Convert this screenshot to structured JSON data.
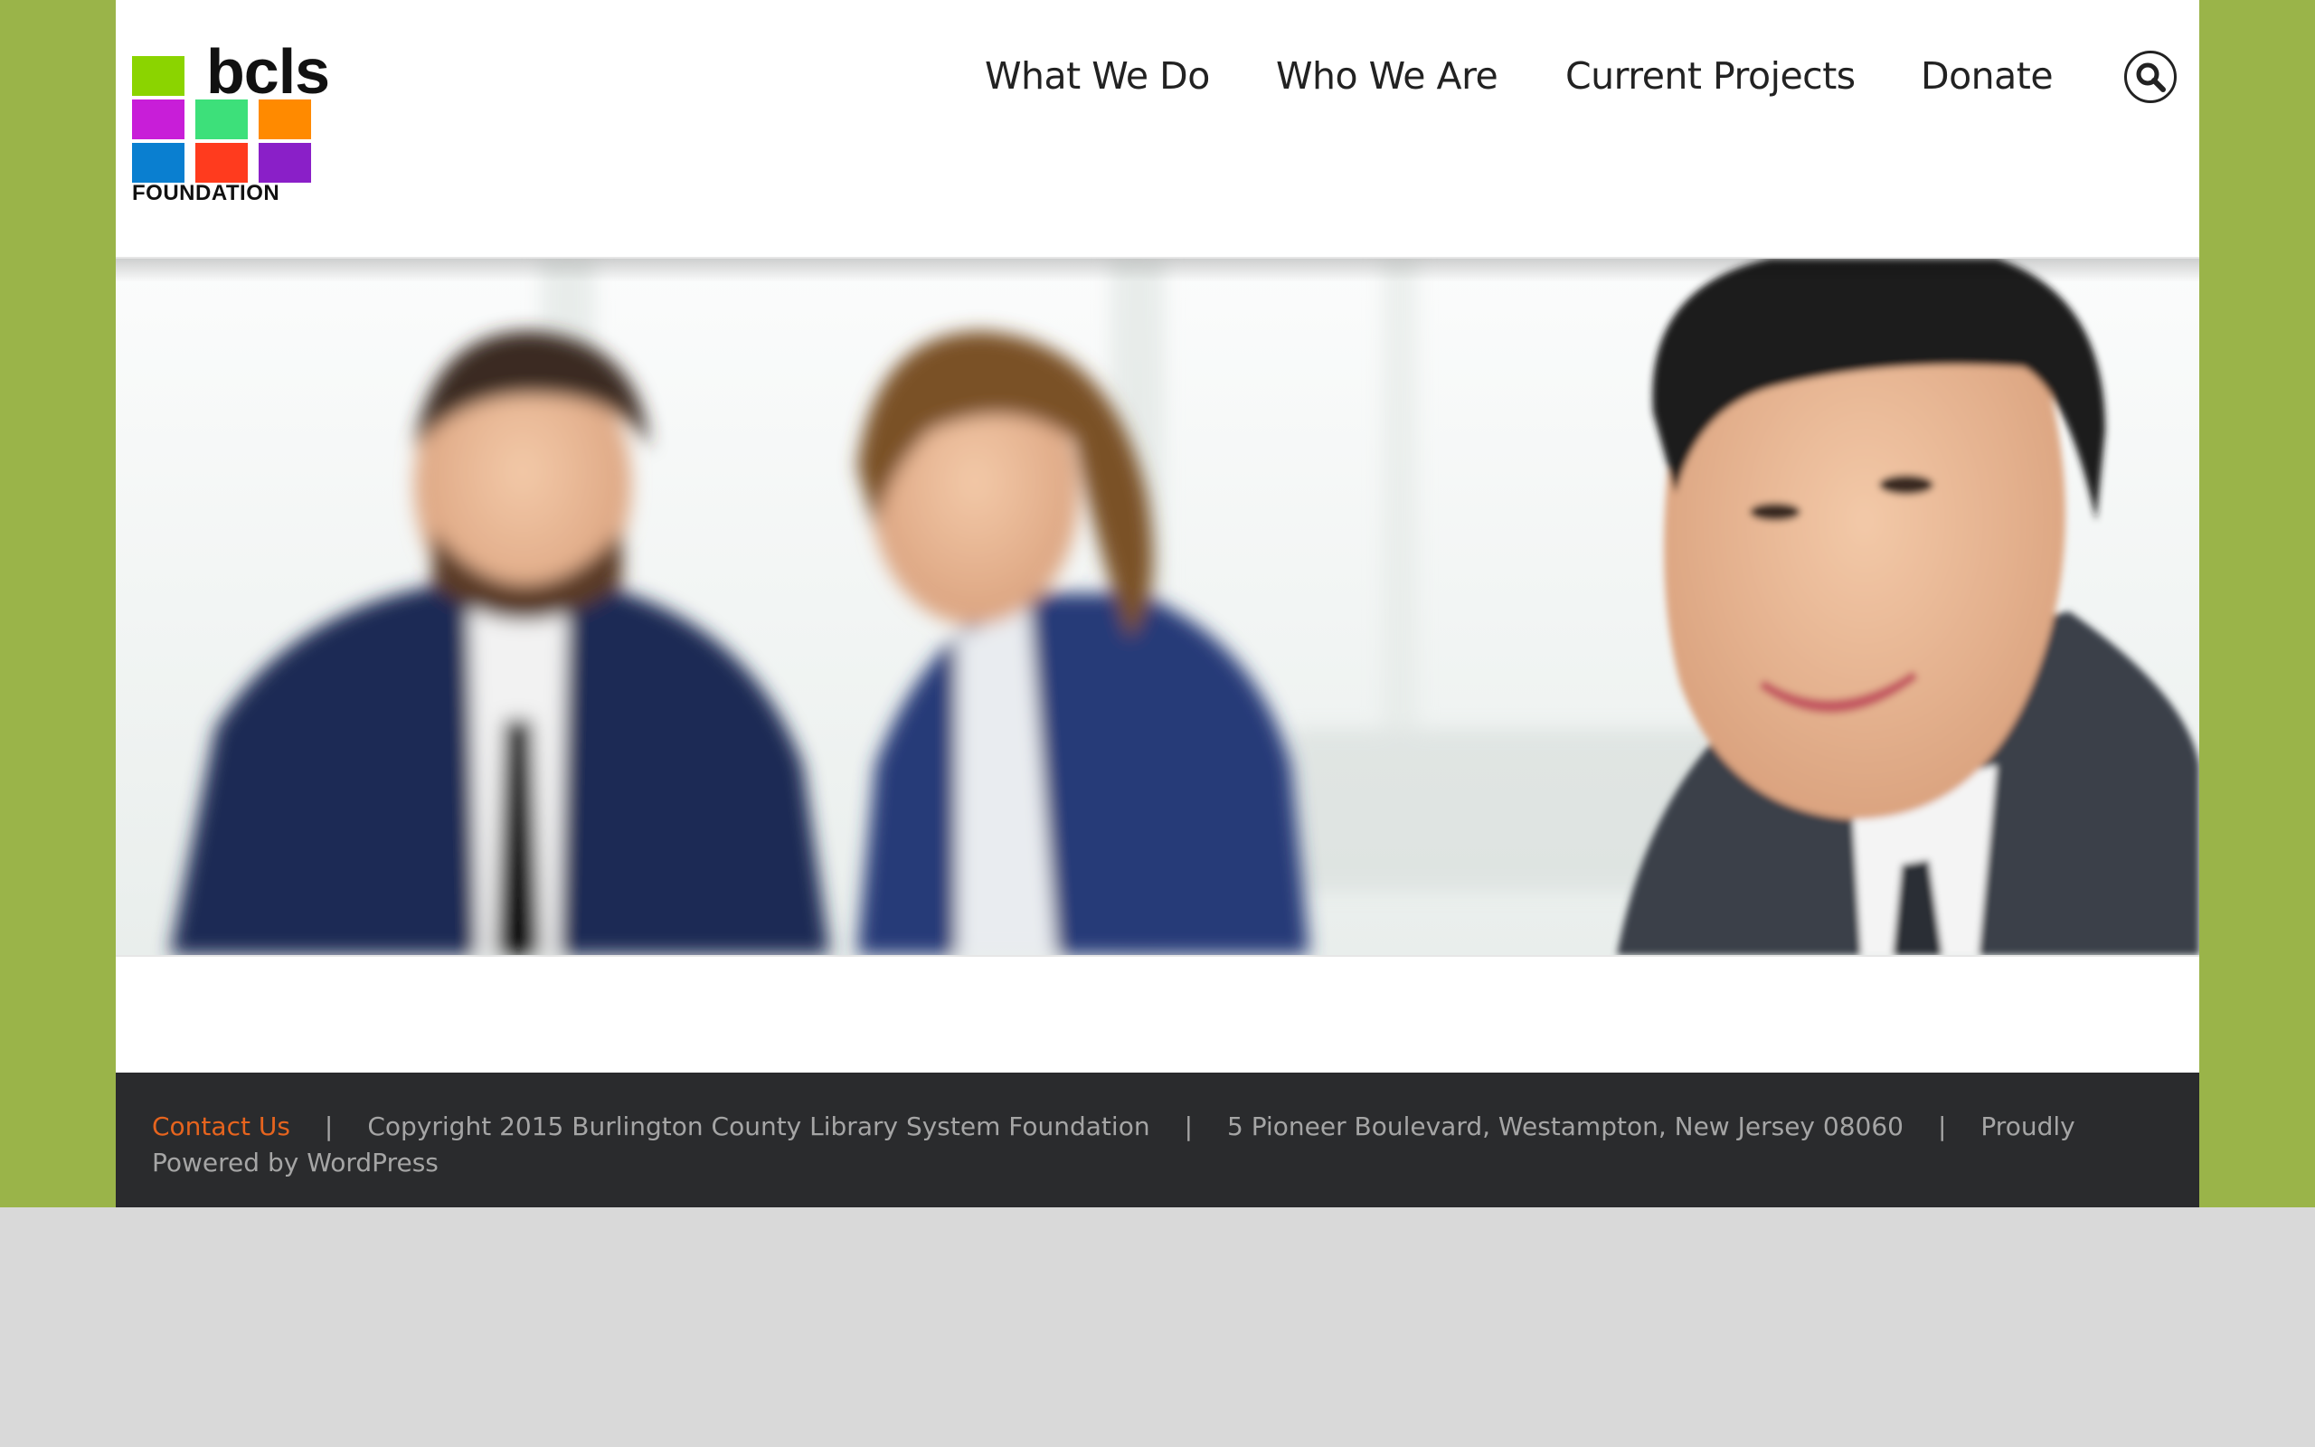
{
  "logo": {
    "word": "bcls",
    "tagline": "FOUNDATION",
    "tile_colors": [
      "#8bd400",
      "#c81ed8",
      "#3de07a",
      "#ff8a00",
      "#0a7fd0",
      "#ff3b1e",
      "#8a1fc8"
    ]
  },
  "nav": {
    "items": [
      {
        "label": "What We Do"
      },
      {
        "label": "Who We Are"
      },
      {
        "label": "Current Projects"
      },
      {
        "label": "Donate"
      }
    ]
  },
  "footer": {
    "contact_label": "Contact Us",
    "separator": "|",
    "copyright": "Copyright 2015 Burlington County Library System Foundation",
    "address": "5 Pioneer Boulevard, Westampton, New Jersey 08060",
    "powered": "Proudly Powered by",
    "wordpress": "WordPress"
  },
  "colors": {
    "page_background": "#9ab449",
    "footer_background": "#2a2b2d",
    "link_accent": "#e6641e"
  }
}
